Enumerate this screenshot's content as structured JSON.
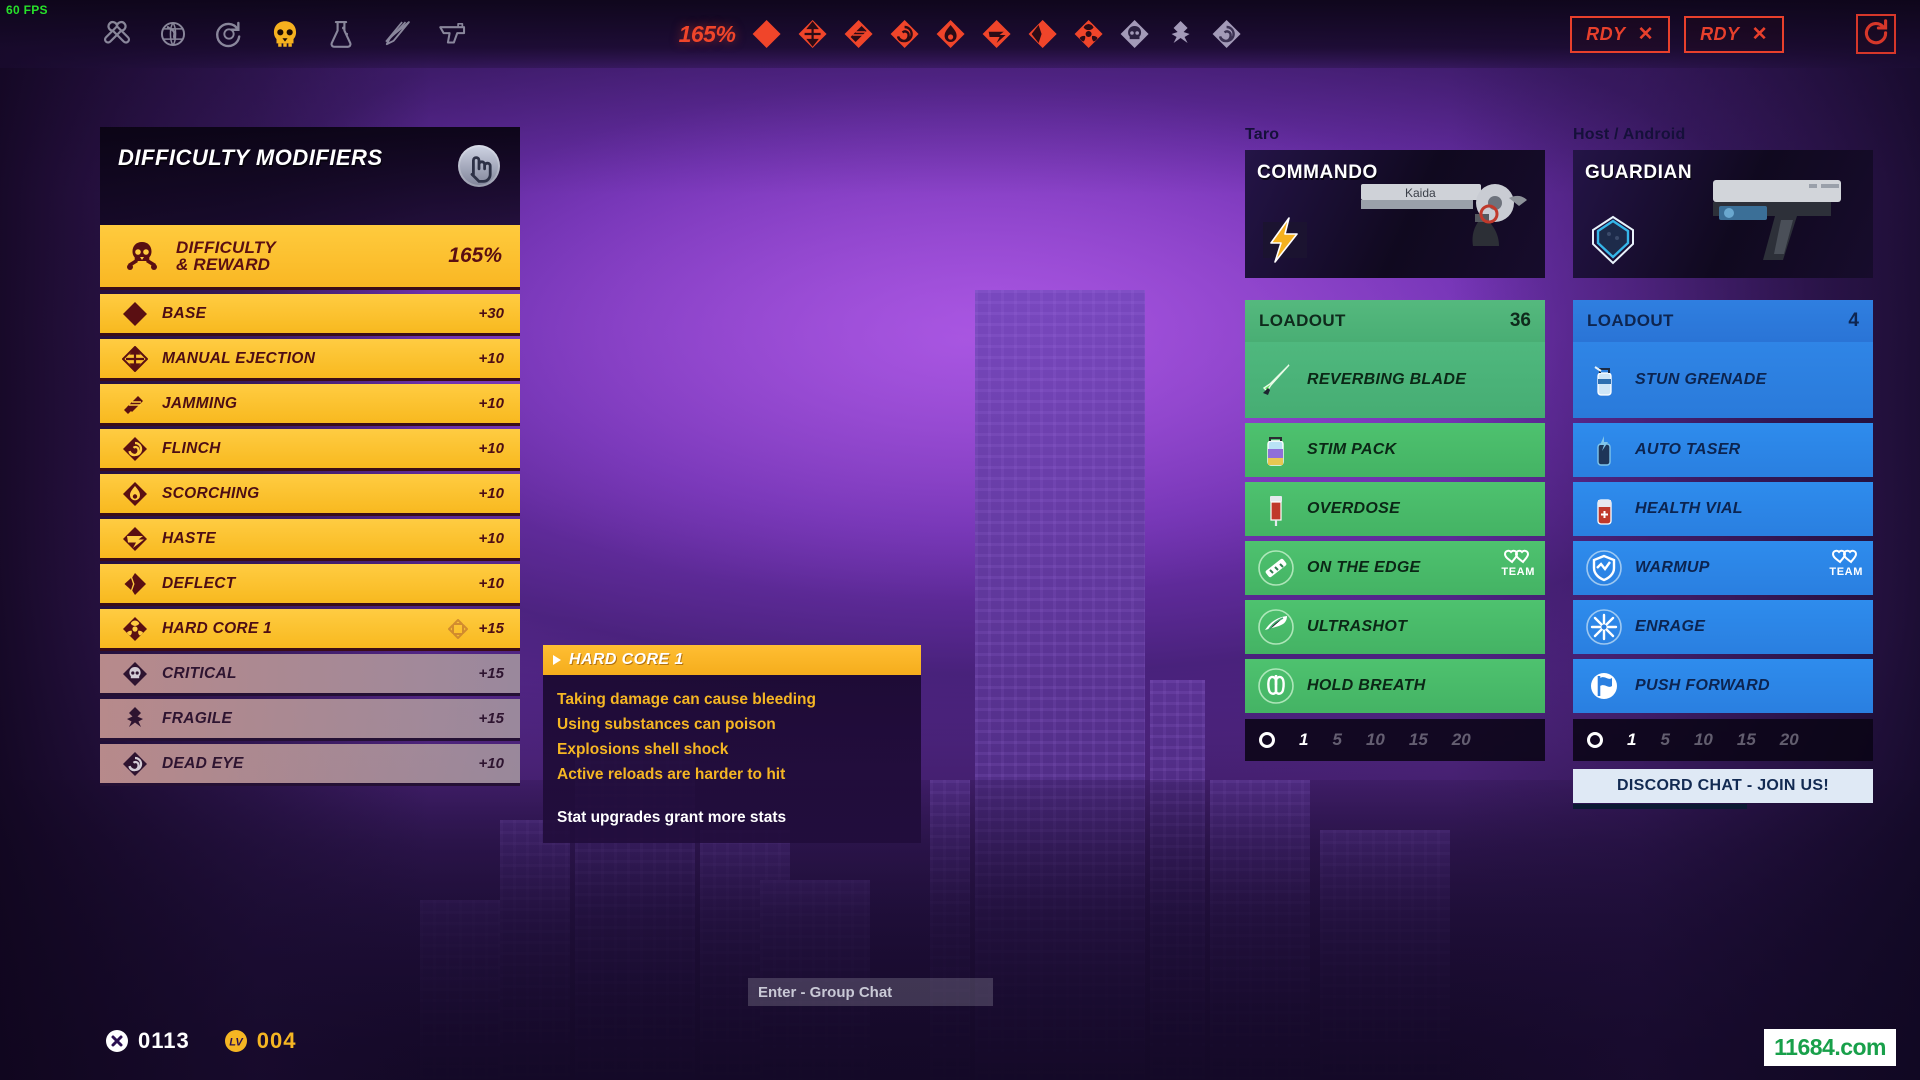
{
  "hud": {
    "fps": "60 FPS",
    "nav_icons": [
      "wrench-tools-icon",
      "globe-icon",
      "recycle-icon",
      "skull-icon",
      "flask-icon",
      "knives-icon",
      "pistol-icon"
    ],
    "difficulty_percent": "165%",
    "modifier_icons": [
      "diamond-base-icon",
      "manual-ejection-icon",
      "jamming-icon",
      "flinch-icon",
      "scorching-icon",
      "haste-icon",
      "deflect-icon",
      "hardcore-icon",
      "critical-icon",
      "fragile-icon",
      "dead-eye-icon"
    ],
    "ready_buttons": [
      {
        "label": "RDY",
        "mark": "✕"
      },
      {
        "label": "RDY",
        "mark": "✕"
      }
    ],
    "refresh_icon": "restart-icon"
  },
  "difficulty_panel": {
    "title": "DIFFICULTY MODIFIERS",
    "badge_icon": "hand-swipe-icon",
    "hero": {
      "icon": "skull-crossbones-icon",
      "line1": "DIFFICULTY",
      "line2": "& REWARD",
      "value": "165%"
    },
    "rows": [
      {
        "icon": "diamond-base-icon",
        "name": "BASE",
        "value": "+30",
        "enabled": true,
        "cursor": false
      },
      {
        "icon": "manual-ejection-icon",
        "name": "MANUAL EJECTION",
        "value": "+10",
        "enabled": true,
        "cursor": false
      },
      {
        "icon": "jamming-icon",
        "name": "JAMMING",
        "value": "+10",
        "enabled": true,
        "cursor": false
      },
      {
        "icon": "flinch-icon",
        "name": "FLINCH",
        "value": "+10",
        "enabled": true,
        "cursor": false
      },
      {
        "icon": "scorching-icon",
        "name": "SCORCHING",
        "value": "+10",
        "enabled": true,
        "cursor": false
      },
      {
        "icon": "haste-icon",
        "name": "HASTE",
        "value": "+10",
        "enabled": true,
        "cursor": false
      },
      {
        "icon": "deflect-icon",
        "name": "DEFLECT",
        "value": "+10",
        "enabled": true,
        "cursor": false
      },
      {
        "icon": "hardcore-icon",
        "name": "HARD CORE 1",
        "value": "+15",
        "enabled": true,
        "cursor": true
      },
      {
        "icon": "critical-icon",
        "name": "CRITICAL",
        "value": "+15",
        "enabled": false,
        "cursor": false
      },
      {
        "icon": "fragile-icon",
        "name": "FRAGILE",
        "value": "+15",
        "enabled": false,
        "cursor": false
      },
      {
        "icon": "dead-eye-icon",
        "name": "DEAD EYE",
        "value": "+10",
        "enabled": false,
        "cursor": false
      }
    ]
  },
  "tooltip": {
    "title": "HARD CORE 1",
    "lines": [
      "Taking damage can cause bleeding",
      "Using substances can poison",
      "Explosions shell shock",
      "Active reloads are harder to hit"
    ],
    "footer": "Stat upgrades grant more stats"
  },
  "players": [
    {
      "name": "Taro",
      "class": "COMMANDO",
      "class_icon": "lightning-bolt-icon",
      "weapon_icon": "revolver-icon",
      "weapon_brand": "Kaida",
      "loadout_label": "LOADOUT",
      "loadout_count": "36",
      "items": [
        {
          "icon": "reverbing-blade-icon",
          "name": "REVERBING BLADE",
          "team": false
        },
        {
          "icon": "stim-pack-icon",
          "name": "STIM PACK",
          "team": false
        },
        {
          "icon": "overdose-syringe-icon",
          "name": "OVERDOSE",
          "team": false
        },
        {
          "icon": "on-the-edge-icon",
          "name": "ON THE EDGE",
          "team": true,
          "team_label": "TEAM"
        },
        {
          "icon": "ultrashot-icon",
          "name": "ULTRASHOT",
          "team": false
        },
        {
          "icon": "hold-breath-lungs-icon",
          "name": "HOLD BREATH",
          "team": false
        }
      ],
      "levels": [
        "1",
        "5",
        "10",
        "15",
        "20"
      ],
      "level_selected": "1"
    },
    {
      "name": "Host / Android",
      "class": "GUARDIAN",
      "class_icon": "shield-icon",
      "weapon_icon": "pistol-icon",
      "weapon_brand": "",
      "loadout_label": "LOADOUT",
      "loadout_count": "4",
      "items": [
        {
          "icon": "stun-grenade-icon",
          "name": "STUN GRENADE",
          "team": false
        },
        {
          "icon": "auto-taser-icon",
          "name": "AUTO TASER",
          "team": false
        },
        {
          "icon": "health-vial-icon",
          "name": "HEALTH VIAL",
          "team": false
        },
        {
          "icon": "warmup-shield-icon",
          "name": "WARMUP",
          "team": true,
          "team_label": "TEAM"
        },
        {
          "icon": "enrage-burst-icon",
          "name": "ENRAGE",
          "team": false
        },
        {
          "icon": "push-forward-flag-icon",
          "name": "PUSH FORWARD",
          "team": false
        }
      ],
      "levels": [
        "1",
        "5",
        "10",
        "15",
        "20"
      ],
      "level_selected": "1"
    }
  ],
  "discord_button": "DISCORD CHAT - JOIN US!",
  "chat": {
    "placeholder_text": "Enter - Group Chat"
  },
  "currency": [
    {
      "icon": "x-circle-icon",
      "value": "0113",
      "style": "white"
    },
    {
      "icon": "lv-badge-icon",
      "value": "004",
      "style": "gold"
    }
  ],
  "watermark": "11684.com",
  "colors": {
    "accent_yellow": "#ffcc42",
    "accent_red": "#e8402c",
    "green_panel": "#4ec26f",
    "blue_panel": "#2e8ced",
    "gold_text": "#f5b623"
  }
}
